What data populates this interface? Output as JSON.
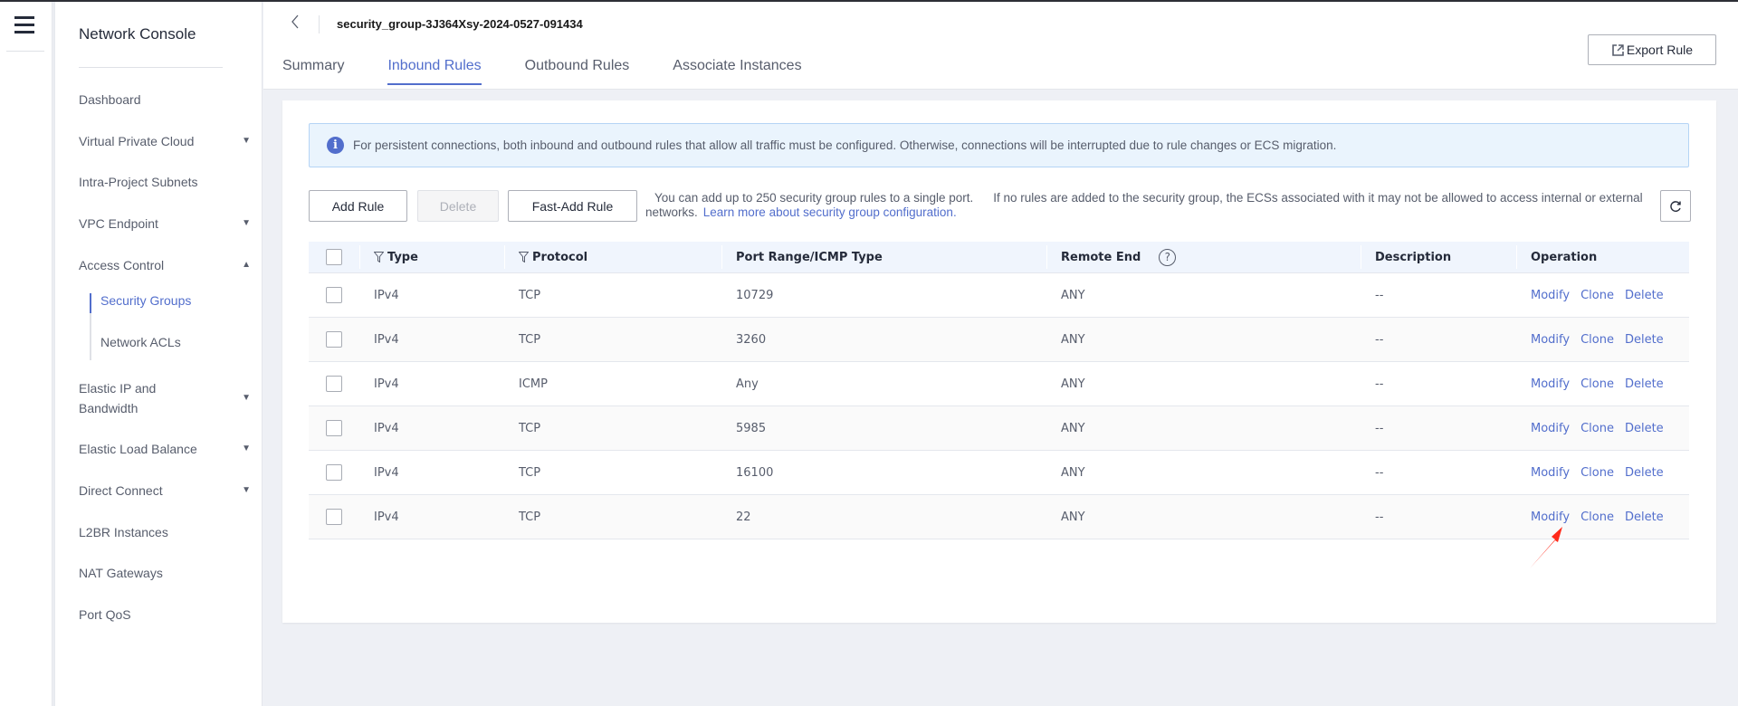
{
  "rail": {
    "menu_icon": "hamburger-menu-icon"
  },
  "sidebar": {
    "title": "Network Console",
    "items": [
      {
        "label": "Dashboard",
        "expandable": false
      },
      {
        "label": "Virtual Private Cloud",
        "expandable": true,
        "expanded": false,
        "arrow": "▼"
      },
      {
        "label": "Intra-Project Subnets",
        "expandable": false
      },
      {
        "label": "VPC Endpoint",
        "expandable": true,
        "expanded": false,
        "arrow": "▼"
      },
      {
        "label": "Access Control",
        "expandable": true,
        "expanded": true,
        "arrow": "▲"
      },
      {
        "label": "Elastic IP and",
        "label_line2": "Bandwidth",
        "expandable": true,
        "expanded": false,
        "arrow": "▼"
      },
      {
        "label": "Elastic Load Balance",
        "expandable": true,
        "expanded": false,
        "arrow": "▼"
      },
      {
        "label": "Direct Connect",
        "expandable": true,
        "expanded": false,
        "arrow": "▼"
      },
      {
        "label": "L2BR Instances",
        "expandable": false
      },
      {
        "label": "NAT Gateways",
        "expandable": false
      },
      {
        "label": "Port QoS",
        "expandable": false
      }
    ],
    "access_control_children": [
      {
        "label": "Security Groups",
        "active": true
      },
      {
        "label": "Network ACLs",
        "active": false
      }
    ]
  },
  "header": {
    "back_icon": "chevron-left-icon",
    "security_group_name": "security_group-3J364Xsy-2024-0527-091434",
    "tabs": [
      {
        "label": "Summary",
        "active": false
      },
      {
        "label": "Inbound Rules",
        "active": true
      },
      {
        "label": "Outbound Rules",
        "active": false
      },
      {
        "label": "Associate Instances",
        "active": false
      }
    ],
    "export_button": "Export Rule"
  },
  "alert": {
    "icon": "info-icon",
    "message": "For persistent connections, both inbound and outbound rules that allow all traffic must be configured. Otherwise, connections will be interrupted due to rule changes or ECS migration."
  },
  "toolbar": {
    "add_rule": "Add Rule",
    "delete": "Delete",
    "fast_add_rule": "Fast-Add Rule",
    "hint_part1": "You can add up to 250 security group rules to a single port.",
    "hint_part2": "If no rules are added to the security group, the ECSs associated with it may not be allowed to access internal or external networks.",
    "learn_more_link": "Learn more about security group configuration.",
    "refresh_icon": "refresh-icon"
  },
  "table": {
    "columns": [
      "Type",
      "Protocol",
      "Port Range/ICMP Type",
      "Remote End",
      "Description",
      "Operation"
    ],
    "rows": [
      {
        "type": "IPv4",
        "protocol": "TCP",
        "port": "10729",
        "remote": "ANY",
        "description": "--"
      },
      {
        "type": "IPv4",
        "protocol": "TCP",
        "port": "3260",
        "remote": "ANY",
        "description": "--"
      },
      {
        "type": "IPv4",
        "protocol": "ICMP",
        "port": "Any",
        "remote": "ANY",
        "description": "--"
      },
      {
        "type": "IPv4",
        "protocol": "TCP",
        "port": "5985",
        "remote": "ANY",
        "description": "--"
      },
      {
        "type": "IPv4",
        "protocol": "TCP",
        "port": "16100",
        "remote": "ANY",
        "description": "--"
      },
      {
        "type": "IPv4",
        "protocol": "TCP",
        "port": "22",
        "remote": "ANY",
        "description": "--"
      }
    ],
    "operations": [
      "Modify",
      "Clone",
      "Delete"
    ],
    "help_glyph": "?"
  },
  "annotation": {
    "type": "red-arrow",
    "points_to": "Modify (row 6)",
    "color": "#ff2a1a"
  },
  "colors": {
    "accent": "#526ecc",
    "alert_bg": "#eaf4fd",
    "alert_border": "#b5d4f5",
    "page_bg": "#eef0f5",
    "header_row_bg": "#f0f5fd"
  }
}
